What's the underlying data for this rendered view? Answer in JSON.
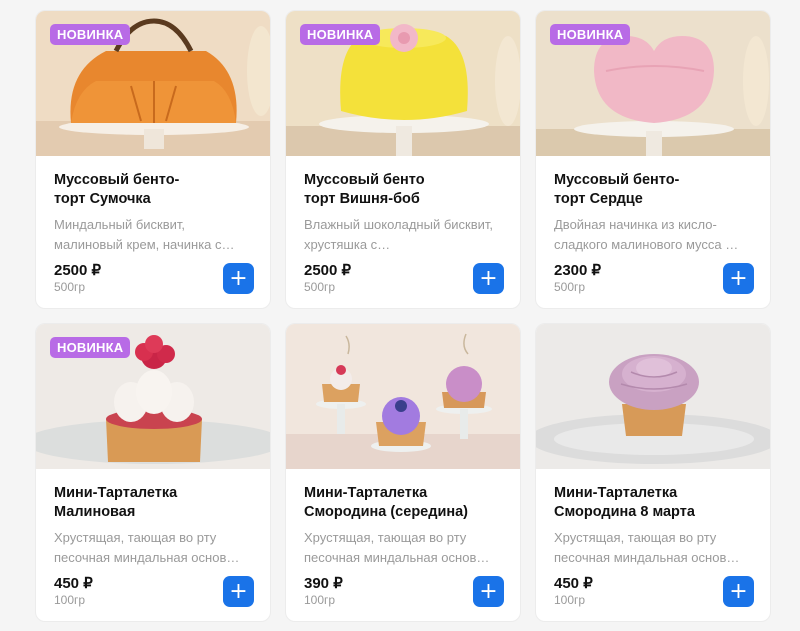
{
  "products": [
    {
      "badge": "НОВИНКА",
      "title": "Муссовый бенто-\nторт Сумочка",
      "description": "Миндальный бисквит, малиновый крем, начинка с…",
      "price": "2500 ₽",
      "weight": "500гр",
      "add_label": "+",
      "image": "orange-bag-cake"
    },
    {
      "badge": "НОВИНКА",
      "title": "Муссовый бенто\nторт Вишня-боб",
      "description": "Влажный шоколадный бисквит, хрустяшка с…",
      "price": "2500 ₽",
      "weight": "500гр",
      "add_label": "+",
      "image": "yellow-flower-cake"
    },
    {
      "badge": "НОВИНКА",
      "title": "Муссовый бенто-\nторт Сердце",
      "description": "Двойная начинка из кисло-сладкого малинового мусса …",
      "price": "2300 ₽",
      "weight": "500гр",
      "add_label": "+",
      "image": "pink-heart-cake"
    },
    {
      "badge": "НОВИНКА",
      "title": "Мини-Тарталетка\nМалиновая",
      "description": "Хрустящая, тающая во рту песочная миндальная основ…",
      "price": "450 ₽",
      "weight": "100гр",
      "add_label": "+",
      "image": "raspberry-tartlet"
    },
    {
      "badge": "",
      "title": "Мини-Тарталетка\nСмородина (середина)",
      "description": "Хрустящая, тающая во рту песочная миндальная основ…",
      "price": "390 ₽",
      "weight": "100гр",
      "add_label": "+",
      "image": "three-tartlets"
    },
    {
      "badge": "",
      "title": "Мини-Тарталетка\nСмородина 8 марта",
      "description": "Хрустящая, тающая во рту песочная миндальная основ…",
      "price": "450 ₽",
      "weight": "100гр",
      "add_label": "+",
      "image": "flower-tartlet"
    }
  ],
  "colors": {
    "badge": "#b86be6",
    "accent": "#1a73e8"
  }
}
